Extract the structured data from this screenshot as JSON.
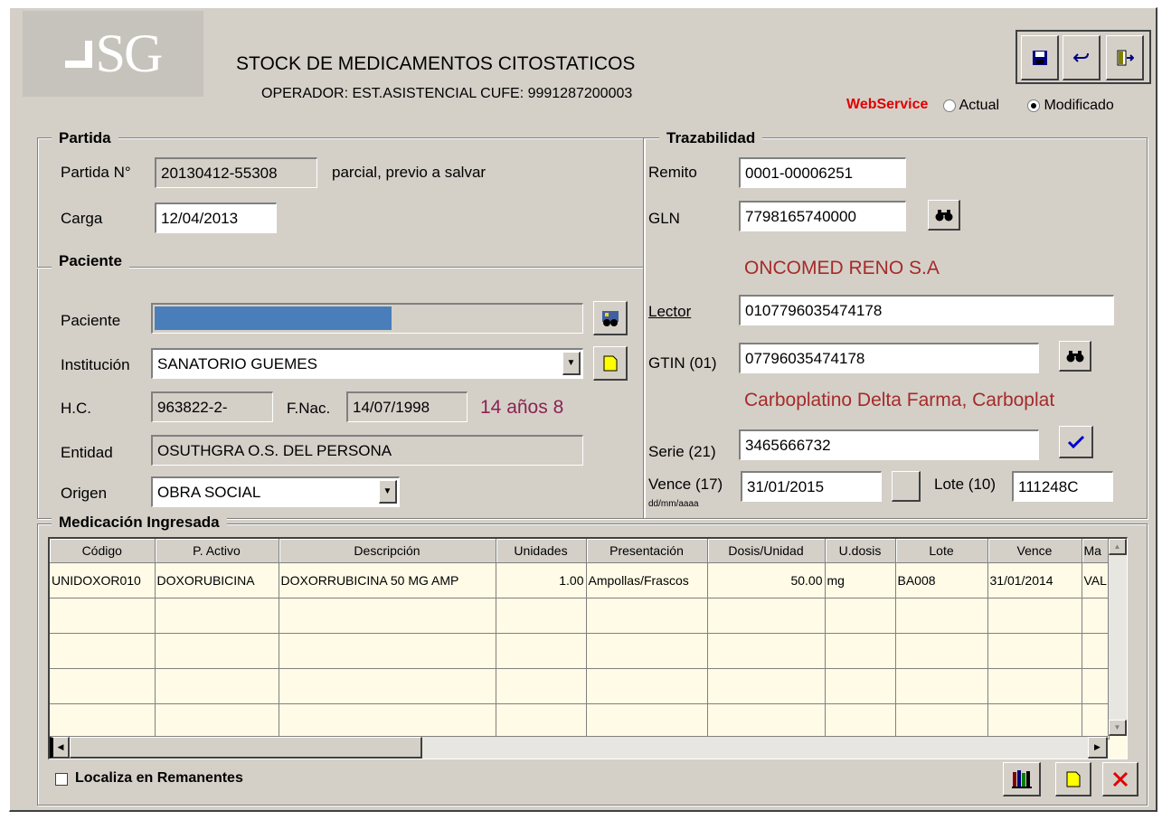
{
  "logo": {
    "text": "SG"
  },
  "header": {
    "title": "STOCK DE MEDICAMENTOS CITOSTATICOS",
    "operator": "OPERADOR: EST.ASISTENCIAL  CUFE: 9991287200003"
  },
  "webservice": {
    "label": "WebService",
    "option_actual": "Actual",
    "option_modificado": "Modificado",
    "selected": "Modificado"
  },
  "partida": {
    "title": "Partida",
    "numero_label": "Partida N°",
    "numero": "20130412-55308",
    "nota": "parcial, previo a salvar",
    "carga_label": "Carga",
    "carga": "12/04/2013"
  },
  "paciente": {
    "title": "Paciente",
    "paciente_label": "Paciente",
    "institucion_label": "Institución",
    "institucion": "SANATORIO GUEMES",
    "hc_label": "H.C.",
    "hc": "963822-2-",
    "fnac_label": "F.Nac.",
    "fnac": "14/07/1998",
    "edad": "14 años 8",
    "entidad_label": "Entidad",
    "entidad": "OSUTHGRA O.S. DEL PERSONA",
    "origen_label": "Origen",
    "origen": "OBRA SOCIAL"
  },
  "trazabilidad": {
    "title": "Trazabilidad",
    "remito_label": "Remito",
    "remito": "0001-00006251",
    "gln_label": "GLN",
    "gln": "7798165740000",
    "gln_name": "ONCOMED RENO S.A",
    "lector_label": "Lector",
    "lector": "0107796035474178",
    "gtin_label": "GTIN (01)",
    "gtin": "07796035474178",
    "gtin_name": "Carboplatino Delta Farma, Carboplat",
    "serie_label": "Serie (21)",
    "serie": "3465666732",
    "vence_label": "Vence (17)",
    "vence": "31/01/2015",
    "vence_hint": "dd/mm/aaaa",
    "lote_label": "Lote (10)",
    "lote": "111248C"
  },
  "medicacion": {
    "title": "Medicación Ingresada",
    "columns": [
      "Código",
      "P. Activo",
      "Descripción",
      "Unidades",
      "Presentación",
      "Dosis/Unidad",
      "U.dosis",
      "Lote",
      "Vence",
      "Ma"
    ],
    "rows": [
      [
        "UNIDOXOR010",
        "DOXORUBICINA",
        "DOXORRUBICINA 50 MG AMP",
        "1.00",
        "Ampollas/Frascos",
        "50.00",
        "mg",
        "BA008",
        "31/01/2014",
        "VAL"
      ]
    ]
  },
  "footer": {
    "localiza_label": "Localiza en Remanentes"
  },
  "colors": {
    "window": "#d4d0c8",
    "grid_bg": "#fffbe6",
    "accent_red": "#e00000",
    "name_red": "#a52a2a",
    "age": "#8b2252",
    "selection": "#4a7ebb"
  }
}
